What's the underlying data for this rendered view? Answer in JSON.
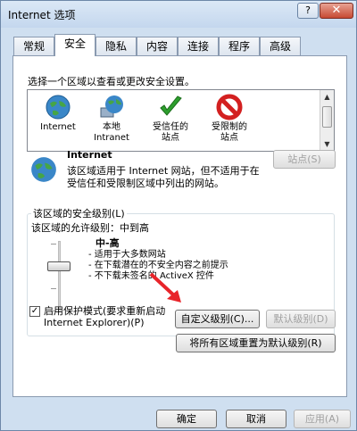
{
  "window": {
    "title": "Internet 选项",
    "help_label": "?",
    "close_label": "✕"
  },
  "tabs": [
    {
      "label": "常规"
    },
    {
      "label": "安全"
    },
    {
      "label": "隐私"
    },
    {
      "label": "内容"
    },
    {
      "label": "连接"
    },
    {
      "label": "程序"
    },
    {
      "label": "高级"
    }
  ],
  "security": {
    "zone_prompt": "选择一个区域以查看或更改安全设置。",
    "zones": [
      {
        "line1": "Internet",
        "line2": "",
        "icon": "globe-icon"
      },
      {
        "line1": "本地",
        "line2": "Intranet",
        "icon": "intranet-globe-icon"
      },
      {
        "line1": "受信任的",
        "line2": "站点",
        "icon": "checkmark-icon"
      },
      {
        "line1": "受限制的",
        "line2": "站点",
        "icon": "restricted-icon"
      }
    ],
    "selected_zone": {
      "name": "Internet",
      "description": "该区域适用于 Internet 网站，但不适用于在受信任和受限制区域中列出的网站。"
    },
    "sites_button": "站点(S)",
    "level_group_label": "该区域的安全级别(L)",
    "allowed_levels": "该区域的允许级别：中到高",
    "level_name": "中-高",
    "bullets": [
      "- 适用于大多数网站",
      "- 在下载潜在的不安全内容之前提示",
      "- 不下载未签名的 ActiveX 控件"
    ],
    "protected_mode_checked": true,
    "protected_mode_line1": "启用保护模式(要求重新启动",
    "protected_mode_line2": "Internet Explorer)(P)",
    "custom_level_button": "自定义级别(C)...",
    "default_level_button": "默认级别(D)",
    "reset_all_button": "将所有区域重置为默认级别(R)"
  },
  "footer": {
    "ok": "确定",
    "cancel": "取消",
    "apply": "应用(A)"
  },
  "colors": {
    "window_bg": "#cfdff0",
    "accent_arrow": "#e8242a"
  }
}
